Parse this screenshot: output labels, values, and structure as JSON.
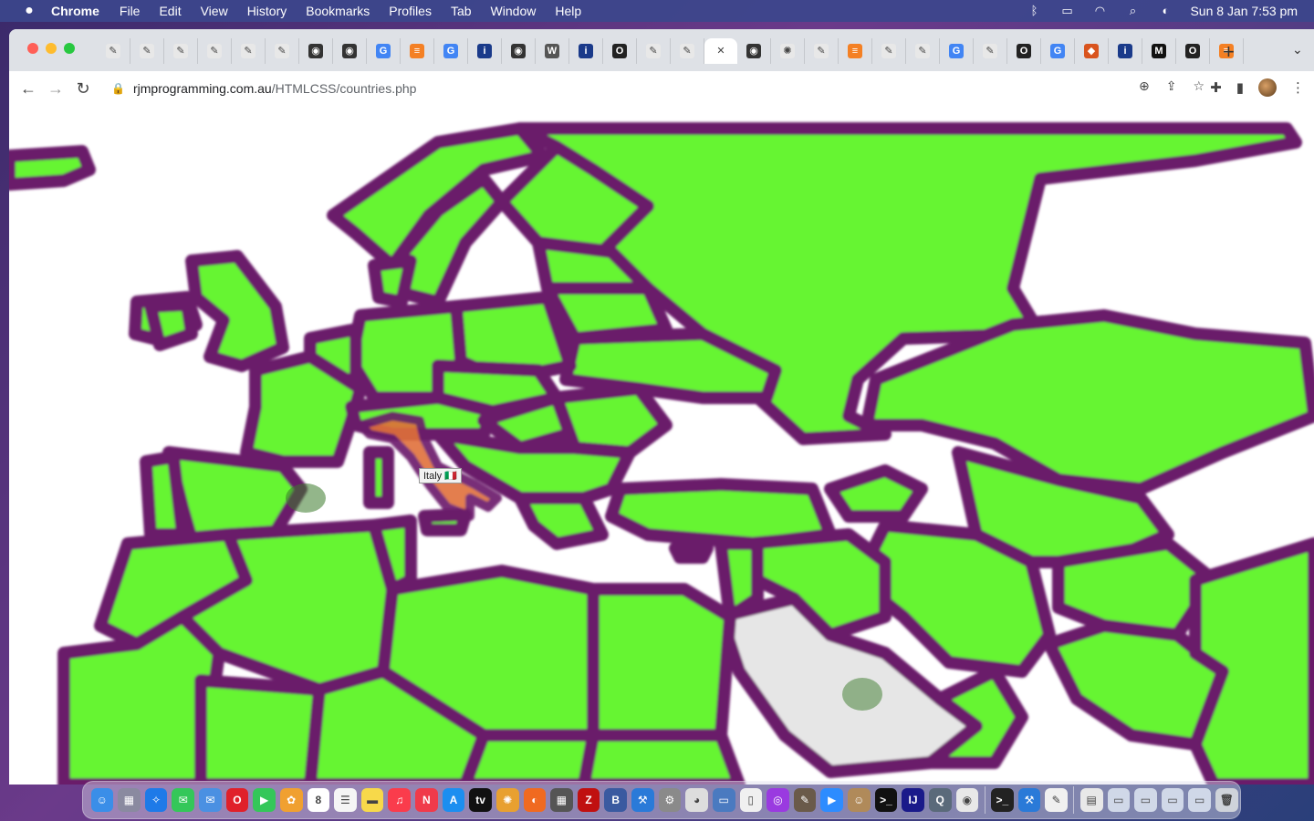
{
  "menubar": {
    "app_name": "Chrome",
    "items": [
      "File",
      "Edit",
      "View",
      "History",
      "Bookmarks",
      "Profiles",
      "Tab",
      "Window",
      "Help"
    ],
    "clock": "Sun 8 Jan  7:53 pm"
  },
  "tabs": [
    {
      "icon": "feather-icon",
      "color": "#e8e8e8",
      "glyph": "✎"
    },
    {
      "icon": "feather-icon",
      "color": "#e8e8e8",
      "glyph": "✎"
    },
    {
      "icon": "feather-icon",
      "color": "#e8e8e8",
      "glyph": "✎"
    },
    {
      "icon": "feather-icon",
      "color": "#e8e8e8",
      "glyph": "✎"
    },
    {
      "icon": "feather-icon",
      "color": "#e8e8e8",
      "glyph": "✎"
    },
    {
      "icon": "feather-icon",
      "color": "#e8e8e8",
      "glyph": "✎"
    },
    {
      "icon": "github-icon",
      "color": "#333333",
      "glyph": "◉"
    },
    {
      "icon": "github-icon",
      "color": "#333333",
      "glyph": "◉"
    },
    {
      "icon": "google-icon",
      "color": "#4285f4",
      "glyph": "G"
    },
    {
      "icon": "stackoverflow-icon",
      "color": "#f48024",
      "glyph": "≡"
    },
    {
      "icon": "google-icon",
      "color": "#4285f4",
      "glyph": "G"
    },
    {
      "icon": "info-icon",
      "color": "#1a3a8a",
      "glyph": "i"
    },
    {
      "icon": "github-icon",
      "color": "#333333",
      "glyph": "◉"
    },
    {
      "icon": "wikipedia-icon",
      "color": "#555555",
      "glyph": "W"
    },
    {
      "icon": "info-icon",
      "color": "#1a3a8a",
      "glyph": "i"
    },
    {
      "icon": "opera-icon",
      "color": "#222222",
      "glyph": "O"
    },
    {
      "icon": "feather-icon",
      "color": "#e8e8e8",
      "glyph": "✎"
    },
    {
      "icon": "feather-icon",
      "color": "#e8e8e8",
      "glyph": "✎"
    },
    {
      "icon": "close-icon",
      "color": "#ffffff",
      "glyph": "✕",
      "active": true
    },
    {
      "icon": "github-icon",
      "color": "#333333",
      "glyph": "◉"
    },
    {
      "icon": "spinner-icon",
      "color": "#e8e8e8",
      "glyph": "✺"
    },
    {
      "icon": "feather-icon",
      "color": "#e8e8e8",
      "glyph": "✎"
    },
    {
      "icon": "stackoverflow-icon",
      "color": "#f48024",
      "glyph": "≡"
    },
    {
      "icon": "feather-icon",
      "color": "#e8e8e8",
      "glyph": "✎"
    },
    {
      "icon": "feather-icon",
      "color": "#e8e8e8",
      "glyph": "✎"
    },
    {
      "icon": "google-icon",
      "color": "#4285f4",
      "glyph": "G"
    },
    {
      "icon": "feather-icon",
      "color": "#e8e8e8",
      "glyph": "✎"
    },
    {
      "icon": "opera-icon",
      "color": "#222222",
      "glyph": "O"
    },
    {
      "icon": "google-icon",
      "color": "#4285f4",
      "glyph": "G"
    },
    {
      "icon": "shield-icon",
      "color": "#d9541e",
      "glyph": "◆"
    },
    {
      "icon": "info-icon",
      "color": "#1a3a8a",
      "glyph": "i"
    },
    {
      "icon": "medium-icon",
      "color": "#111111",
      "glyph": "M"
    },
    {
      "icon": "opera-icon",
      "color": "#222222",
      "glyph": "O"
    },
    {
      "icon": "stackoverflow-icon",
      "color": "#f48024",
      "glyph": "≡"
    }
  ],
  "address": {
    "host": "rjmprogramming.com.au",
    "path": "/HTMLCSS/countries.php"
  },
  "map": {
    "tooltip": "Italy 🇮🇹",
    "land_color": "#66f532",
    "border_color": "#6b1a6b",
    "highlight_color": "#e0703a"
  },
  "dock": [
    {
      "icon": "finder-icon",
      "color": "#3a8ee8",
      "glyph": "☺"
    },
    {
      "icon": "launchpad-icon",
      "color": "#8a8aa0",
      "glyph": "▦"
    },
    {
      "icon": "safari-icon",
      "color": "#1e7ae8",
      "glyph": "✧"
    },
    {
      "icon": "messages-icon",
      "color": "#34c759",
      "glyph": "✉"
    },
    {
      "icon": "mail-icon",
      "color": "#4a90e2",
      "glyph": "✉"
    },
    {
      "icon": "opera-icon",
      "color": "#e0202a",
      "glyph": "O"
    },
    {
      "icon": "facetime-icon",
      "color": "#34c759",
      "glyph": "▶"
    },
    {
      "icon": "photos-icon",
      "color": "#f0a030",
      "glyph": "✿"
    },
    {
      "icon": "calendar-icon",
      "color": "#ffffff",
      "glyph": "8"
    },
    {
      "icon": "reminders-icon",
      "color": "#f5f5f5",
      "glyph": "☰"
    },
    {
      "icon": "notes-icon",
      "color": "#f7d94a",
      "glyph": "▬"
    },
    {
      "icon": "music-icon",
      "color": "#fa3c4c",
      "glyph": "♫"
    },
    {
      "icon": "news-icon",
      "color": "#f03a4a",
      "glyph": "N"
    },
    {
      "icon": "appstore-icon",
      "color": "#1c8ef0",
      "glyph": "A"
    },
    {
      "icon": "appletv-icon",
      "color": "#111111",
      "glyph": "tv"
    },
    {
      "icon": "pinwheel-icon",
      "color": "#e8a030",
      "glyph": "✺"
    },
    {
      "icon": "firefox-icon",
      "color": "#f06a20",
      "glyph": "◐"
    },
    {
      "icon": "calculator-icon",
      "color": "#555555",
      "glyph": "▦"
    },
    {
      "icon": "filezilla-icon",
      "color": "#c01010",
      "glyph": "Z"
    },
    {
      "icon": "bbedit-icon",
      "color": "#3a5aa0",
      "glyph": "B"
    },
    {
      "icon": "xcode-icon",
      "color": "#2a7ad8",
      "glyph": "⚒"
    },
    {
      "icon": "settings-icon",
      "color": "#8a8a8a",
      "glyph": "⚙"
    },
    {
      "icon": "elephant-icon",
      "color": "#dddddd",
      "glyph": "◕"
    },
    {
      "icon": "preview-icon",
      "color": "#4a7ac0",
      "glyph": "▭"
    },
    {
      "icon": "document-icon",
      "color": "#f0f0f0",
      "glyph": "▯"
    },
    {
      "icon": "podcasts-icon",
      "color": "#9a3ae0",
      "glyph": "◎"
    },
    {
      "icon": "gimp-icon",
      "color": "#6a5a4a",
      "glyph": "✎"
    },
    {
      "icon": "zoom-icon",
      "color": "#2d8cff",
      "glyph": "▶"
    },
    {
      "icon": "contacts-icon",
      "color": "#b08a5a",
      "glyph": "☺"
    },
    {
      "icon": "terminal-icon",
      "color": "#111111",
      "glyph": ">_"
    },
    {
      "icon": "intellij-icon",
      "color": "#1a1a8a",
      "glyph": "IJ"
    },
    {
      "icon": "quicktime-icon",
      "color": "#5a6a7a",
      "glyph": "Q"
    },
    {
      "icon": "chrome-icon",
      "color": "#e8e8e8",
      "glyph": "◉"
    },
    {
      "sep": true
    },
    {
      "icon": "terminal-window-icon",
      "color": "#222222",
      "glyph": ">_"
    },
    {
      "icon": "xcode-window-icon",
      "color": "#2a7ad8",
      "glyph": "⚒"
    },
    {
      "icon": "textedit-icon",
      "color": "#f0f0f0",
      "glyph": "✎"
    },
    {
      "sep": true
    },
    {
      "icon": "download-stack-icon",
      "color": "#e8e8e8",
      "glyph": "▤"
    },
    {
      "icon": "window-thumb-icon",
      "color": "#d0d8e8",
      "glyph": "▭"
    },
    {
      "icon": "window-thumb-icon",
      "color": "#d0d8e8",
      "glyph": "▭"
    },
    {
      "icon": "window-thumb-icon",
      "color": "#d0d8e8",
      "glyph": "▭"
    },
    {
      "icon": "window-thumb-icon",
      "color": "#d0d8e8",
      "glyph": "▭"
    },
    {
      "icon": "trash-icon",
      "color": "#cfd3da",
      "glyph": "🗑"
    }
  ]
}
